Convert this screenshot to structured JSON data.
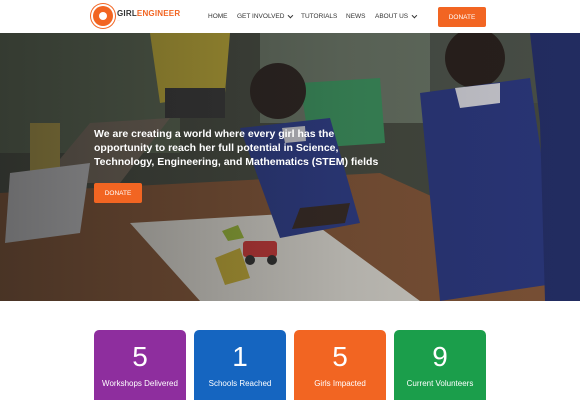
{
  "brand": {
    "name_part1": "GIRL",
    "name_part2": "ENGINEER",
    "tagline": "...",
    "color": "#f26522"
  },
  "nav": {
    "items": [
      {
        "label": "HOME",
        "has_dropdown": false
      },
      {
        "label": "GET INVOLVED",
        "has_dropdown": true
      },
      {
        "label": "TUTORIALS",
        "has_dropdown": false
      },
      {
        "label": "NEWS",
        "has_dropdown": false
      },
      {
        "label": "ABOUT US",
        "has_dropdown": true
      }
    ],
    "donate_label": "DONATE",
    "dropdown_icon": "chevron-down-icon"
  },
  "hero": {
    "heading": "We are creating a world where every girl has the opportunity to reach her full potential in Science, Technology, Engineering, and Mathematics (STEM) fields",
    "donate_label": "DONATE"
  },
  "stats": [
    {
      "number": "5",
      "label": "Workshops Delivered",
      "color": "#8e2e9e"
    },
    {
      "number": "1",
      "label": "Schools Reached",
      "color": "#1565c0"
    },
    {
      "number": "5",
      "label": "Girls Impacted",
      "color": "#f26522"
    },
    {
      "number": "9",
      "label": "Current Volunteers",
      "color": "#1b9e4b"
    }
  ]
}
